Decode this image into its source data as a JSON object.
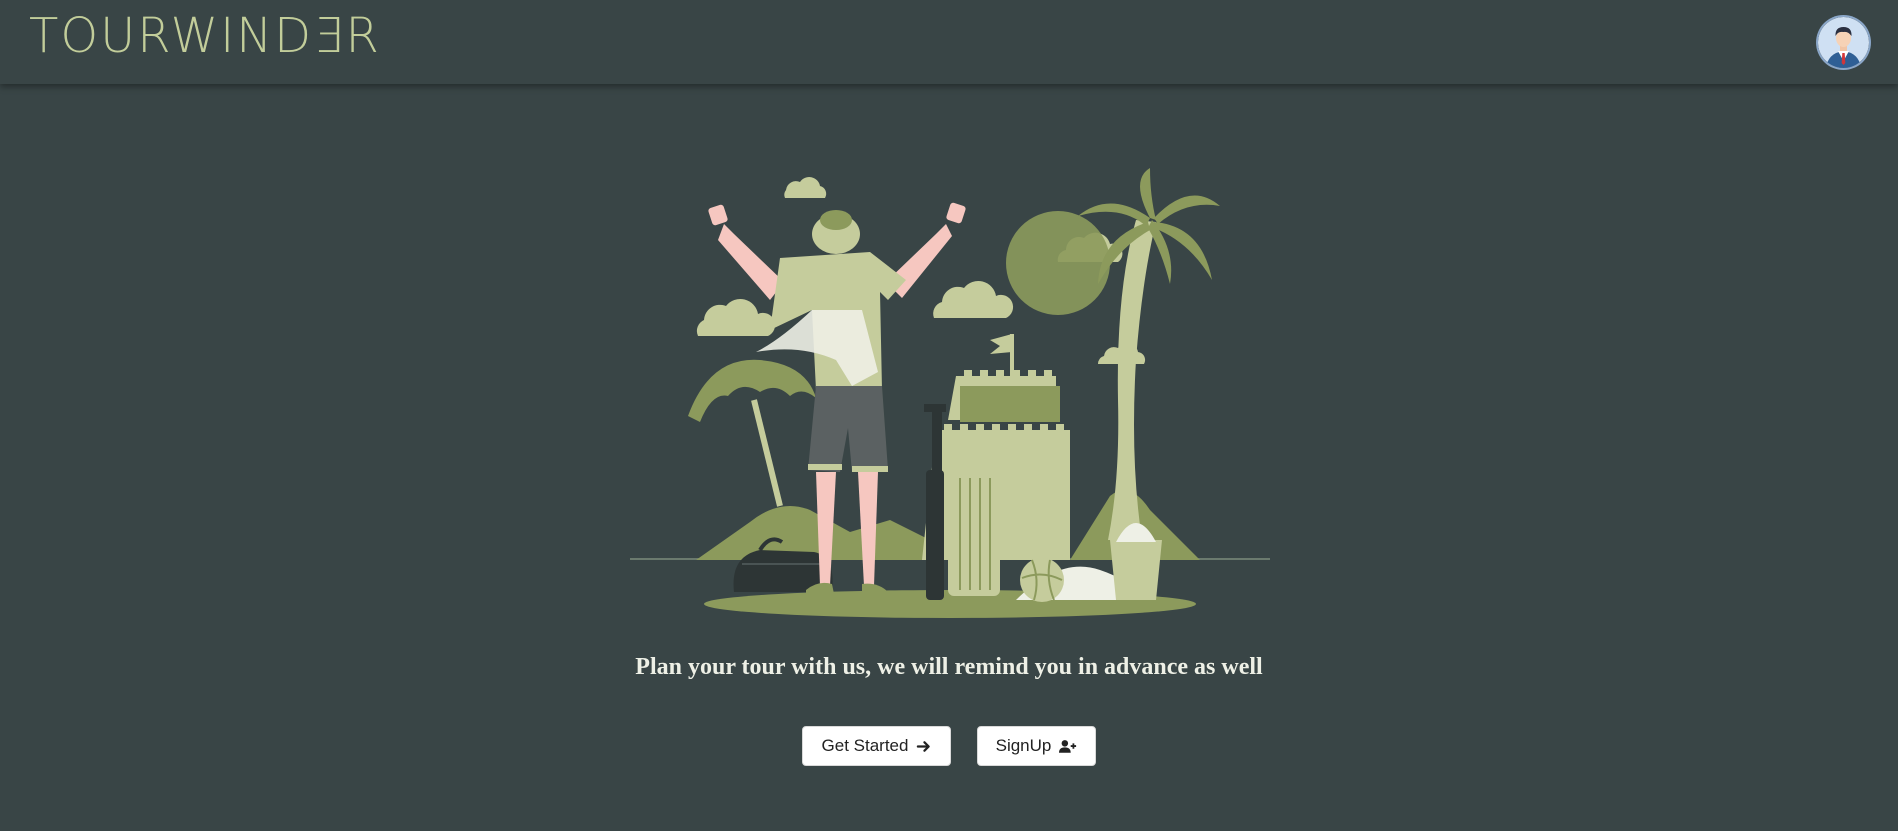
{
  "navbar": {
    "logo_text": "TOURWINDƎR",
    "avatar_icon": "user-avatar-icon"
  },
  "hero": {
    "illustration": "traveler-at-beach-illustration",
    "tagline": "Plan your tour with us, we will remind you in advance as well"
  },
  "actions": {
    "get_started_label": "Get Started",
    "get_started_icon": "arrow-right-icon",
    "signup_label": "SignUp",
    "signup_icon": "user-plus-icon"
  },
  "colors": {
    "background": "#394546",
    "logo": "#c2cd9a",
    "accent_dark": "#8c9a5c",
    "accent_light": "#c5cc9c",
    "button_bg": "#ffffff"
  }
}
